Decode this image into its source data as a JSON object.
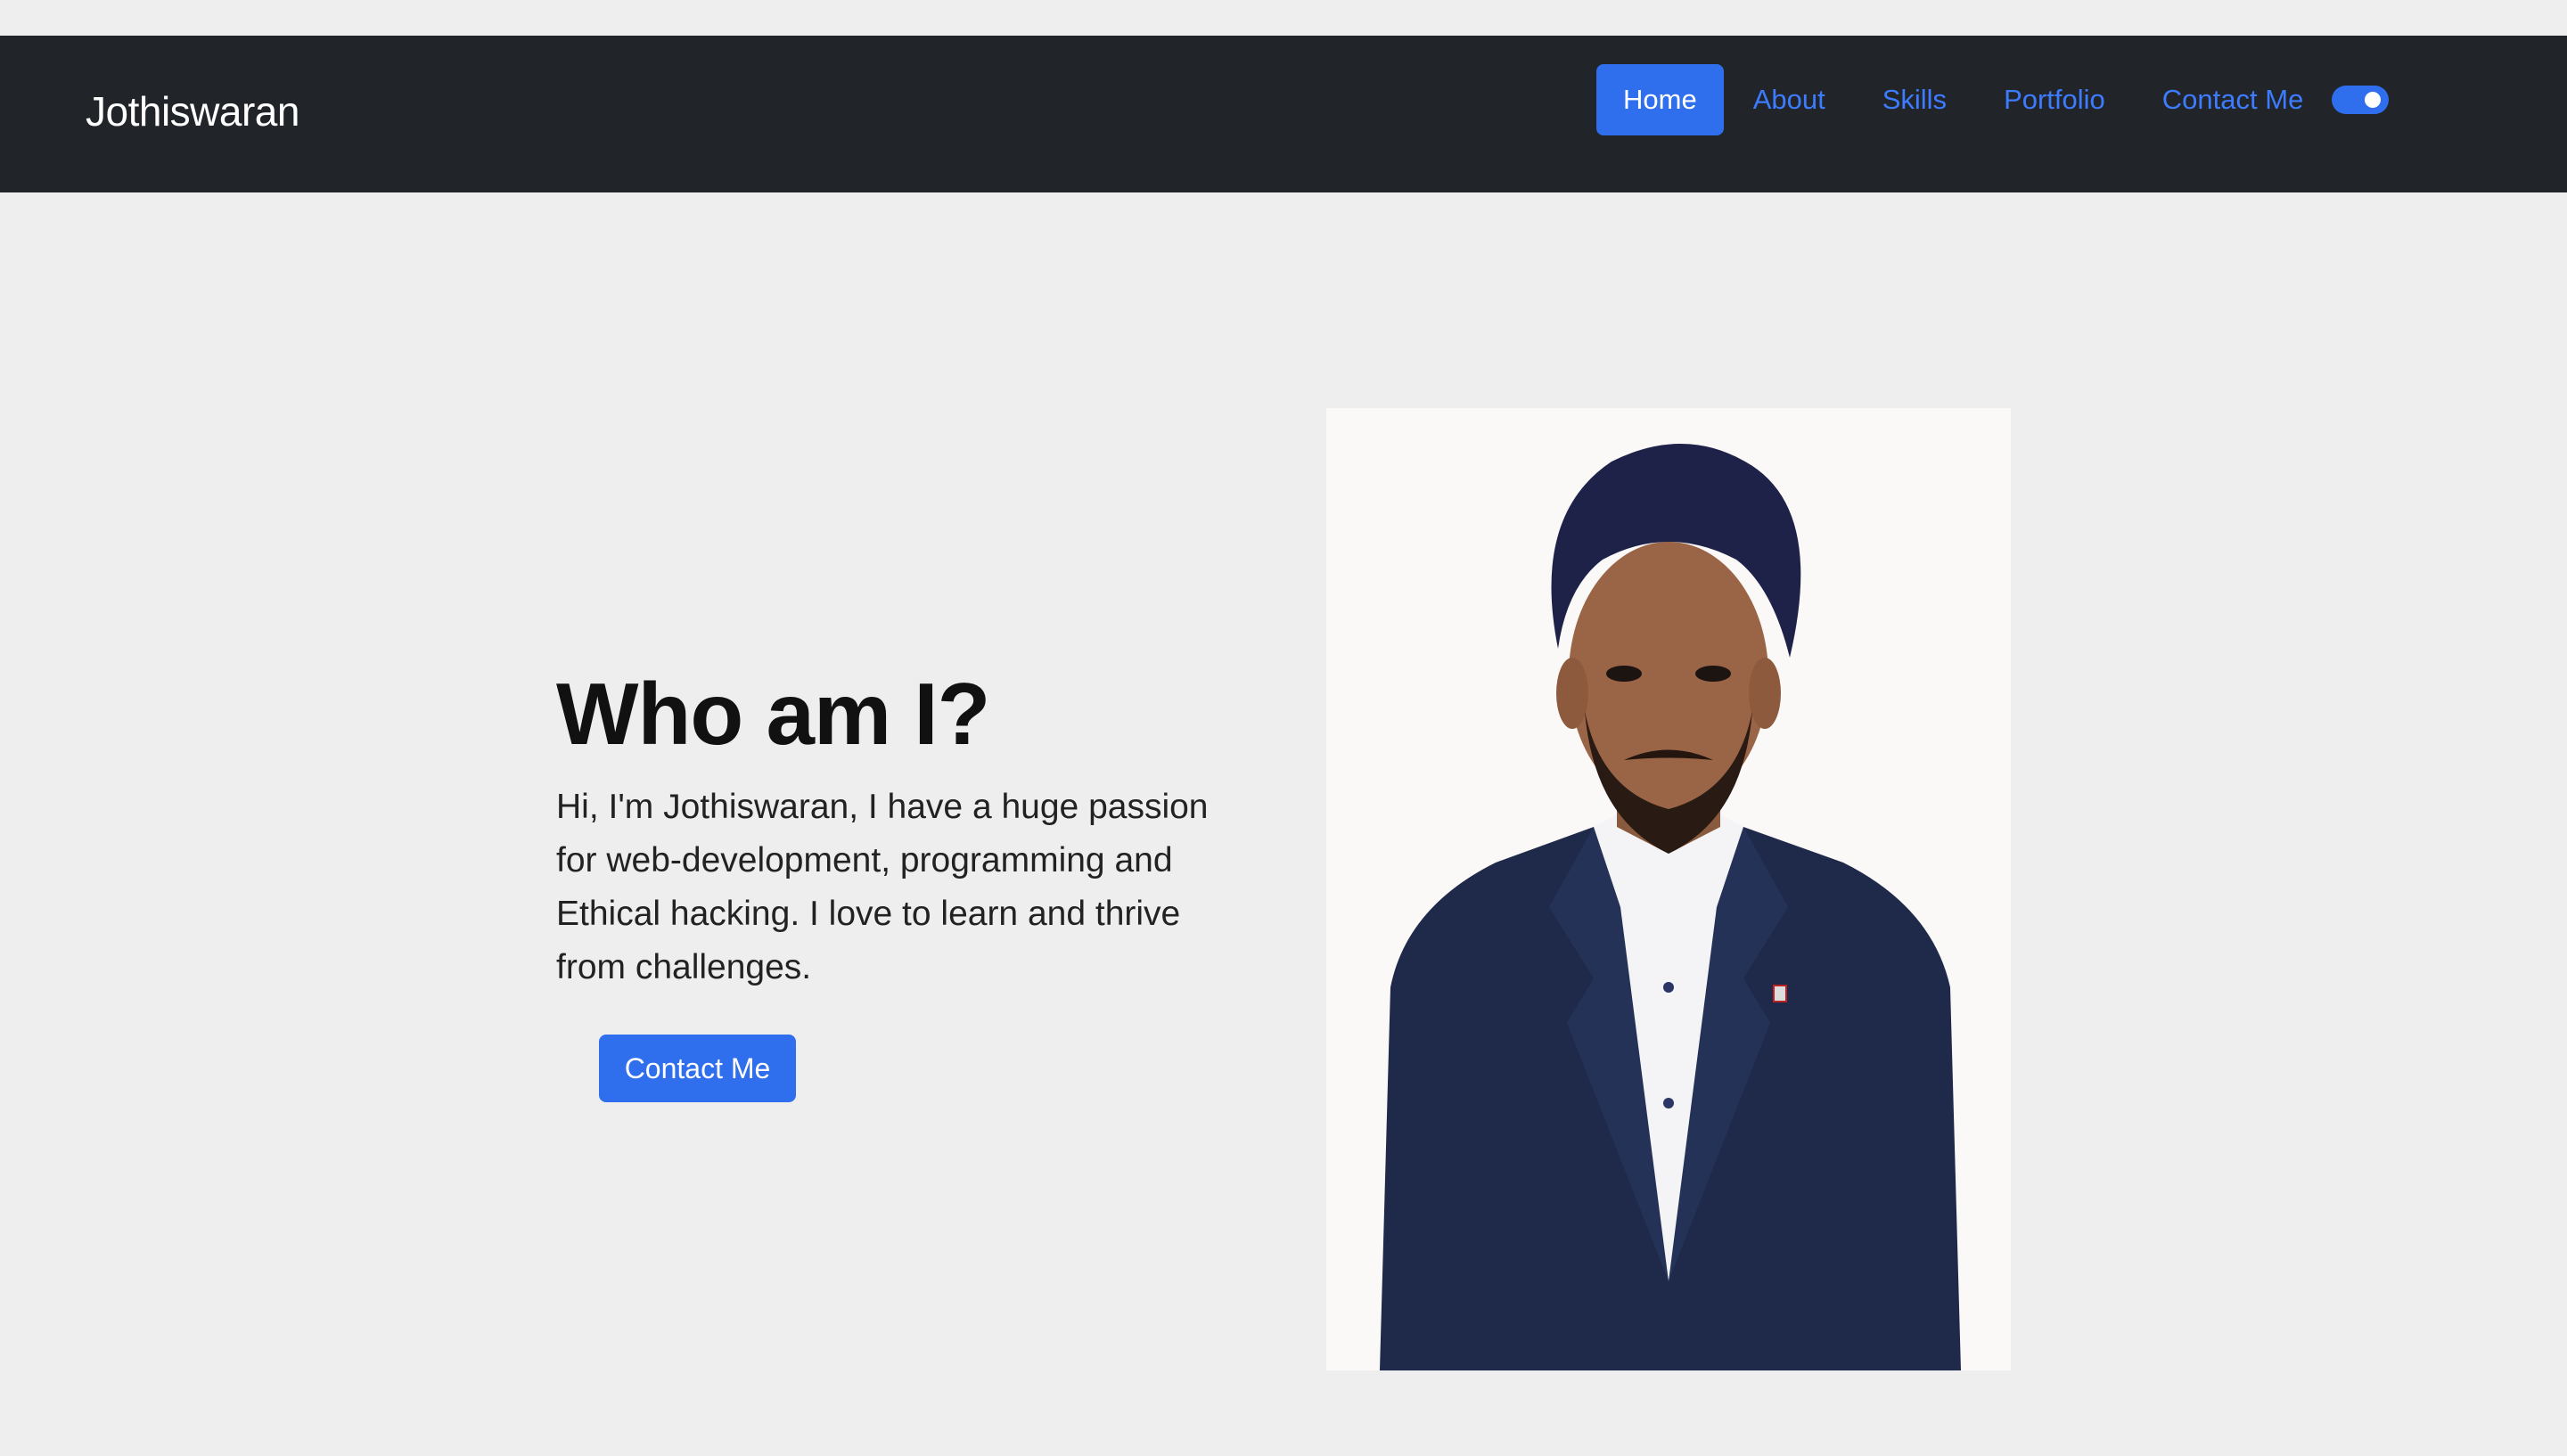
{
  "navbar": {
    "brand": "Jothiswaran",
    "links": [
      {
        "label": "Home",
        "active": true
      },
      {
        "label": "About",
        "active": false
      },
      {
        "label": "Skills",
        "active": false
      },
      {
        "label": "Portfolio",
        "active": false
      },
      {
        "label": "Contact Me",
        "active": false
      }
    ],
    "theme_toggle": {
      "on": true
    }
  },
  "hero": {
    "title": "Who am I?",
    "description": "Hi, I'm Jothiswaran, I have a huge passion for web-development, programming and Ethical hacking. I love to learn and thrive from challenges.",
    "button_label": "Contact Me",
    "photo_icon": "portrait-photo"
  },
  "colors": {
    "navbar_bg": "#212529",
    "page_bg": "#eeeeee",
    "accent": "#2f6fee",
    "link": "#3d7bff"
  }
}
